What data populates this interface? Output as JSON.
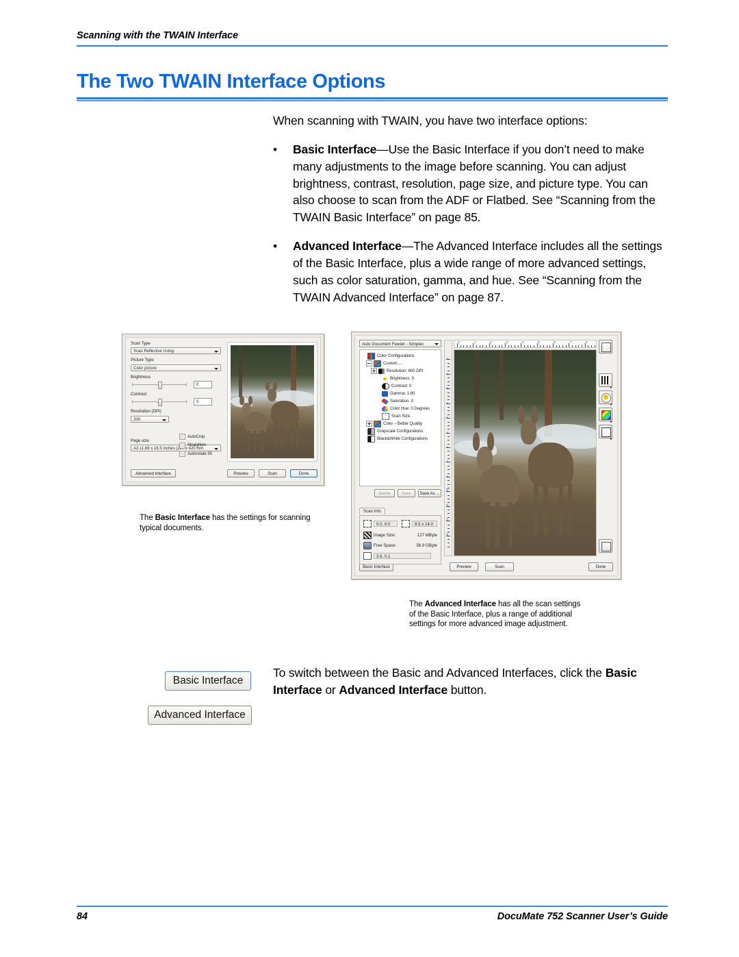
{
  "header": {
    "running_head": "Scanning with the TWAIN Interface",
    "section_title": "The Two TWAIN Interface Options"
  },
  "body": {
    "intro": "When scanning with TWAIN, you have two interface options:",
    "bullet_mark": "•",
    "bullets": [
      {
        "term": "Basic Interface",
        "rest": "—Use the Basic Interface if you don’t need to make many adjustments to the image before scanning. You can adjust brightness, contrast, resolution, page size, and picture type. You can also choose to scan from the ADF or Flatbed. See “Scanning from the TWAIN Basic Interface” on page 85."
      },
      {
        "term": "Advanced Interface",
        "rest": "—The Advanced Interface includes all the settings of the Basic Interface, plus a wide range of more advanced settings, such as color saturation, gamma, and hue. See “Scanning from the TWAIN Advanced Interface” on page 87."
      }
    ]
  },
  "basic_dialog": {
    "scan_type_label": "Scan Type",
    "scan_type_value": "Scan Reflective Using:",
    "picture_type_label": "Picture Type",
    "picture_type_value": "Color picture",
    "brightness_label": "Brightness",
    "brightness_value": "0",
    "contrast_label": "Contrast",
    "contrast_value": "0",
    "resolution_label": "Resolution (DPI)",
    "resolution_value": "200",
    "page_size_label": "Page size",
    "page_size_value": "A3 11.69 x 16.5 inches (297 x 420 mm",
    "checkboxes": [
      {
        "label": "AutoCrop",
        "checked": false
      },
      {
        "label": "Straighten",
        "checked": false
      },
      {
        "label": "Autorotate 90",
        "checked": false
      }
    ],
    "advanced_interface_button": "Advanced Interface",
    "preview_button": "Preview",
    "scan_button": "Scan",
    "done_button": "Done"
  },
  "advanced_dialog": {
    "source_combo_value": "Auto Document Feeder - Simplex",
    "tree": [
      {
        "label": "Color Configurations",
        "depth": 0,
        "icon": "color-config-icon",
        "twisty": "none"
      },
      {
        "label": "Custom ...",
        "depth": 1,
        "icon": "folder-config-icon",
        "twisty": "minus"
      },
      {
        "label": "Resolution: 600 DPI",
        "depth": 2,
        "icon": "resolution-icon",
        "twisty": "plus"
      },
      {
        "label": "Brightness: 0",
        "depth": 3,
        "icon": "brightness-icon",
        "twisty": "none"
      },
      {
        "label": "Contrast: 0",
        "depth": 3,
        "icon": "contrast-icon",
        "twisty": "none"
      },
      {
        "label": "Gamma: 1.80",
        "depth": 3,
        "icon": "gamma-icon",
        "twisty": "none"
      },
      {
        "label": "Saturation: 0",
        "depth": 3,
        "icon": "saturation-icon",
        "twisty": "none"
      },
      {
        "label": "Color Hue: 0 Degrees",
        "depth": 3,
        "icon": "color-hue-icon",
        "twisty": "none"
      },
      {
        "label": "Scan Size",
        "depth": 3,
        "icon": "scan-size-icon",
        "twisty": "none"
      },
      {
        "label": "Color – Better Quality",
        "depth": 1,
        "icon": "folder-config-icon",
        "twisty": "plus"
      },
      {
        "label": "Grayscale Configurations",
        "depth": 0,
        "icon": "grayscale-config-icon",
        "twisty": "none"
      },
      {
        "label": "Black&White Configurations",
        "depth": 0,
        "icon": "bw-config-icon",
        "twisty": "none"
      }
    ],
    "delete_button": "Delete",
    "save_button": "Save",
    "save_as_button": "Save As ...",
    "scan_info_tab": "Scan Info",
    "scan_info": {
      "origin": "0.0, 0.0",
      "dimensions": "8.5 x 14.0",
      "image_size_label": "Image Size:",
      "image_size_value": "127 MByte",
      "free_space_label": "Free Space:",
      "free_space_value": "56.9 GByte",
      "cursor_position": "3.6, 0.1"
    },
    "ruler_marks": [
      "0",
      "1",
      "2",
      "3",
      "4",
      "5",
      "6",
      "7",
      "8"
    ],
    "vruler_marks": [
      "1",
      "2",
      "3",
      "4",
      "5",
      "6",
      "7",
      "8",
      "9",
      "10",
      "11",
      "12",
      "13"
    ],
    "tools": [
      {
        "name": "new-config-icon"
      },
      {
        "name": "descreen-icon"
      },
      {
        "name": "brightness-contrast-icon"
      },
      {
        "name": "color-curve-icon"
      },
      {
        "name": "scan-area-icon"
      },
      {
        "name": "help-icon"
      }
    ],
    "basic_interface_button": "Basic Interface",
    "preview_button": "Preview",
    "scan_button": "Scan",
    "done_button": "Done"
  },
  "captions": {
    "basic": {
      "pre": "The ",
      "bold": "Basic Interface",
      "post": " has the settings for scanning typical documents."
    },
    "advanced": {
      "pre": "The ",
      "bold": "Advanced Interface",
      "post": " has all the scan settings of the Basic Interface, plus a range of additional settings for more advanced image adjustment."
    }
  },
  "switch_section": {
    "basic_button": "Basic Interface",
    "advanced_button": "Advanced Interface",
    "line1": "To switch between the Basic and Advanced Interfaces, click the",
    "line2_b1": "Basic Interface",
    "line2_mid": " or ",
    "line2_b2": "Advanced Interface",
    "line2_end": " button."
  },
  "footer": {
    "page_number": "84",
    "guide_title": "DocuMate 752 Scanner User’s Guide"
  },
  "colors": {
    "accent_blue": "#1068e0",
    "rule_blue": "#2f7bd8"
  }
}
